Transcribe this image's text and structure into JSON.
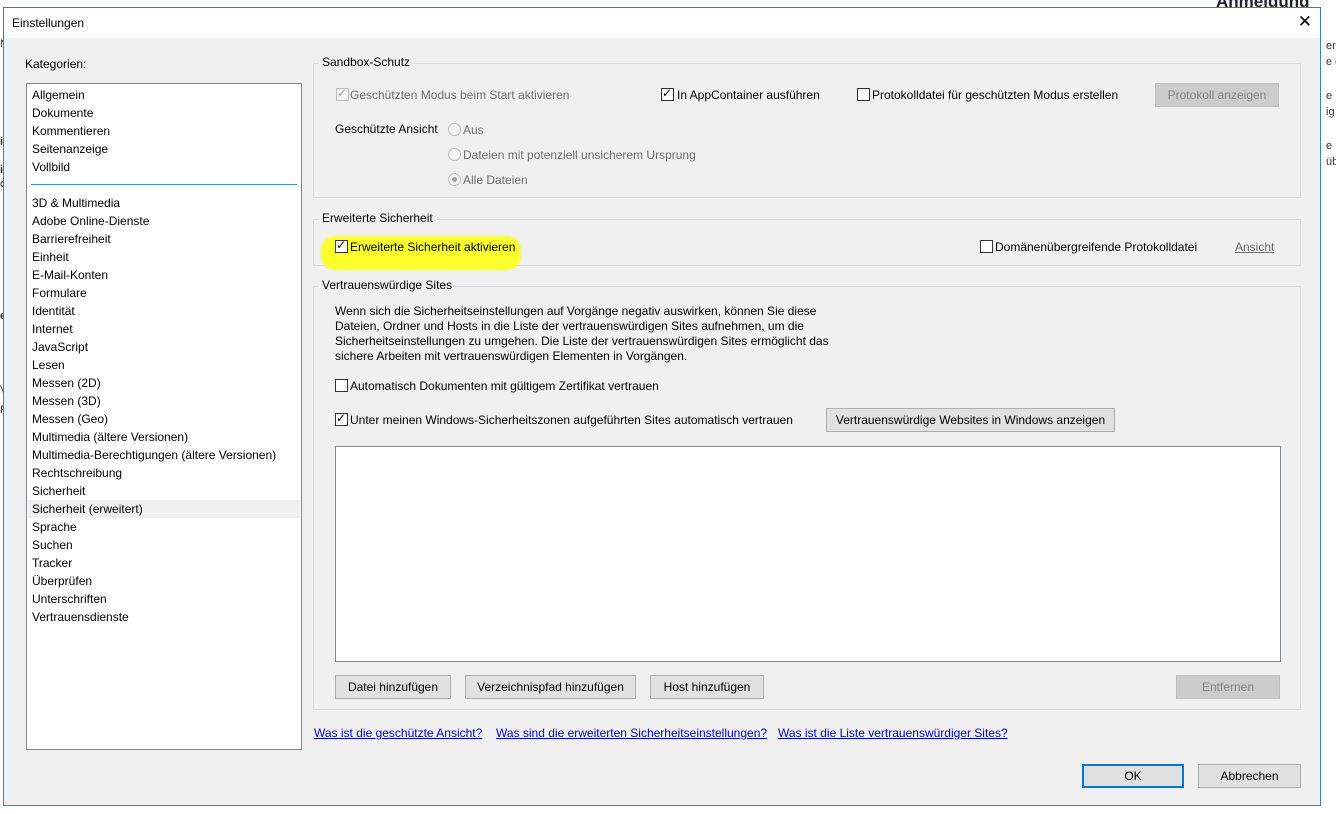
{
  "background": {
    "heading_fragment": "Anmeldung",
    "fragments_right": [
      "erm",
      "e g",
      "e Ih",
      "ig",
      "e P",
      "üb"
    ],
    "fragments_left": [
      "N",
      "i",
      "i",
      "ch",
      "er",
      "V",
      "R"
    ]
  },
  "dialog": {
    "title": "Einstellungen",
    "close_glyph": "✕"
  },
  "categories": {
    "label": "Kategorien:",
    "group1": [
      "Allgemein",
      "Dokumente",
      "Kommentieren",
      "Seitenanzeige",
      "Vollbild"
    ],
    "group2": [
      "3D & Multimedia",
      "Adobe Online-Dienste",
      "Barrierefreiheit",
      "Einheit",
      "E-Mail-Konten",
      "Formulare",
      "Identität",
      "Internet",
      "JavaScript",
      "Lesen",
      "Messen (2D)",
      "Messen (3D)",
      "Messen (Geo)",
      "Multimedia (ältere Versionen)",
      "Multimedia-Berechtigungen (ältere Versionen)",
      "Rechtschreibung",
      "Sicherheit",
      "Sicherheit (erweitert)",
      "Sprache",
      "Suchen",
      "Tracker",
      "Überprüfen",
      "Unterschriften",
      "Vertrauensdienste"
    ],
    "selected": "Sicherheit (erweitert)"
  },
  "sandbox": {
    "title": "Sandbox-Schutz",
    "protected_mode_label": "Geschützten Modus beim Start aktivieren",
    "protected_mode_checked": true,
    "appcontainer_label": "In AppContainer ausführen",
    "appcontainer_checked": true,
    "logfile_label": "Protokolldatei für geschützten Modus erstellen",
    "logfile_checked": false,
    "show_log_button": "Protokoll anzeigen",
    "protected_view_label": "Geschützte Ansicht",
    "radio_off": "Aus",
    "radio_unsafe": "Dateien mit potenziell unsicherem Ursprung",
    "radio_all": "Alle Dateien",
    "radio_selected": "Alle Dateien"
  },
  "enhanced": {
    "title": "Erweiterte Sicherheit",
    "enable_label": "Erweiterte Sicherheit aktivieren",
    "enable_checked": true,
    "highlight_color": "#fbff2b",
    "crossdomain_label": "Domänenübergreifende Protokolldatei",
    "crossdomain_checked": false,
    "view_link": "Ansicht"
  },
  "trusted": {
    "title": "Vertrauenswürdige Sites",
    "description": "Wenn sich die Sicherheitseinstellungen auf Vorgänge negativ auswirken,  können Sie diese Dateien, Ordner und Hosts in die Liste der vertrauenswürdigen Sites aufnehmen, um die Sicherheitseinstellungen zu umgehen. Die Liste der vertrauenswürdigen Sites ermöglicht das sichere Arbeiten mit vertrauenswürdigen Elementen in Vorgängen.",
    "auto_cert_label": "Automatisch Dokumenten mit gültigem Zertifikat vertrauen",
    "auto_cert_checked": false,
    "win_zones_label": "Unter meinen Windows-Sicherheitszonen aufgeführten Sites automatisch vertrauen",
    "win_zones_checked": true,
    "show_windows_sites_button": "Vertrauenswürdige Websites in Windows anzeigen",
    "add_file_button": "Datei hinzufügen",
    "add_folder_button": "Verzeichnispfad hinzufügen",
    "add_host_button": "Host hinzufügen",
    "remove_button": "Entfernen"
  },
  "links": {
    "protected_view": "Was ist die geschützte Ansicht?",
    "enhanced_security": "Was sind die erweiterten Sicherheitseinstellungen?",
    "trusted_sites": "Was ist die Liste vertrauenswürdiger Sites?"
  },
  "footer": {
    "ok_button": "OK",
    "cancel_button": "Abbrechen"
  },
  "colors": {
    "accent": "#0078d7",
    "link": "#0000d6",
    "category_separator": "#3d8ec9"
  }
}
